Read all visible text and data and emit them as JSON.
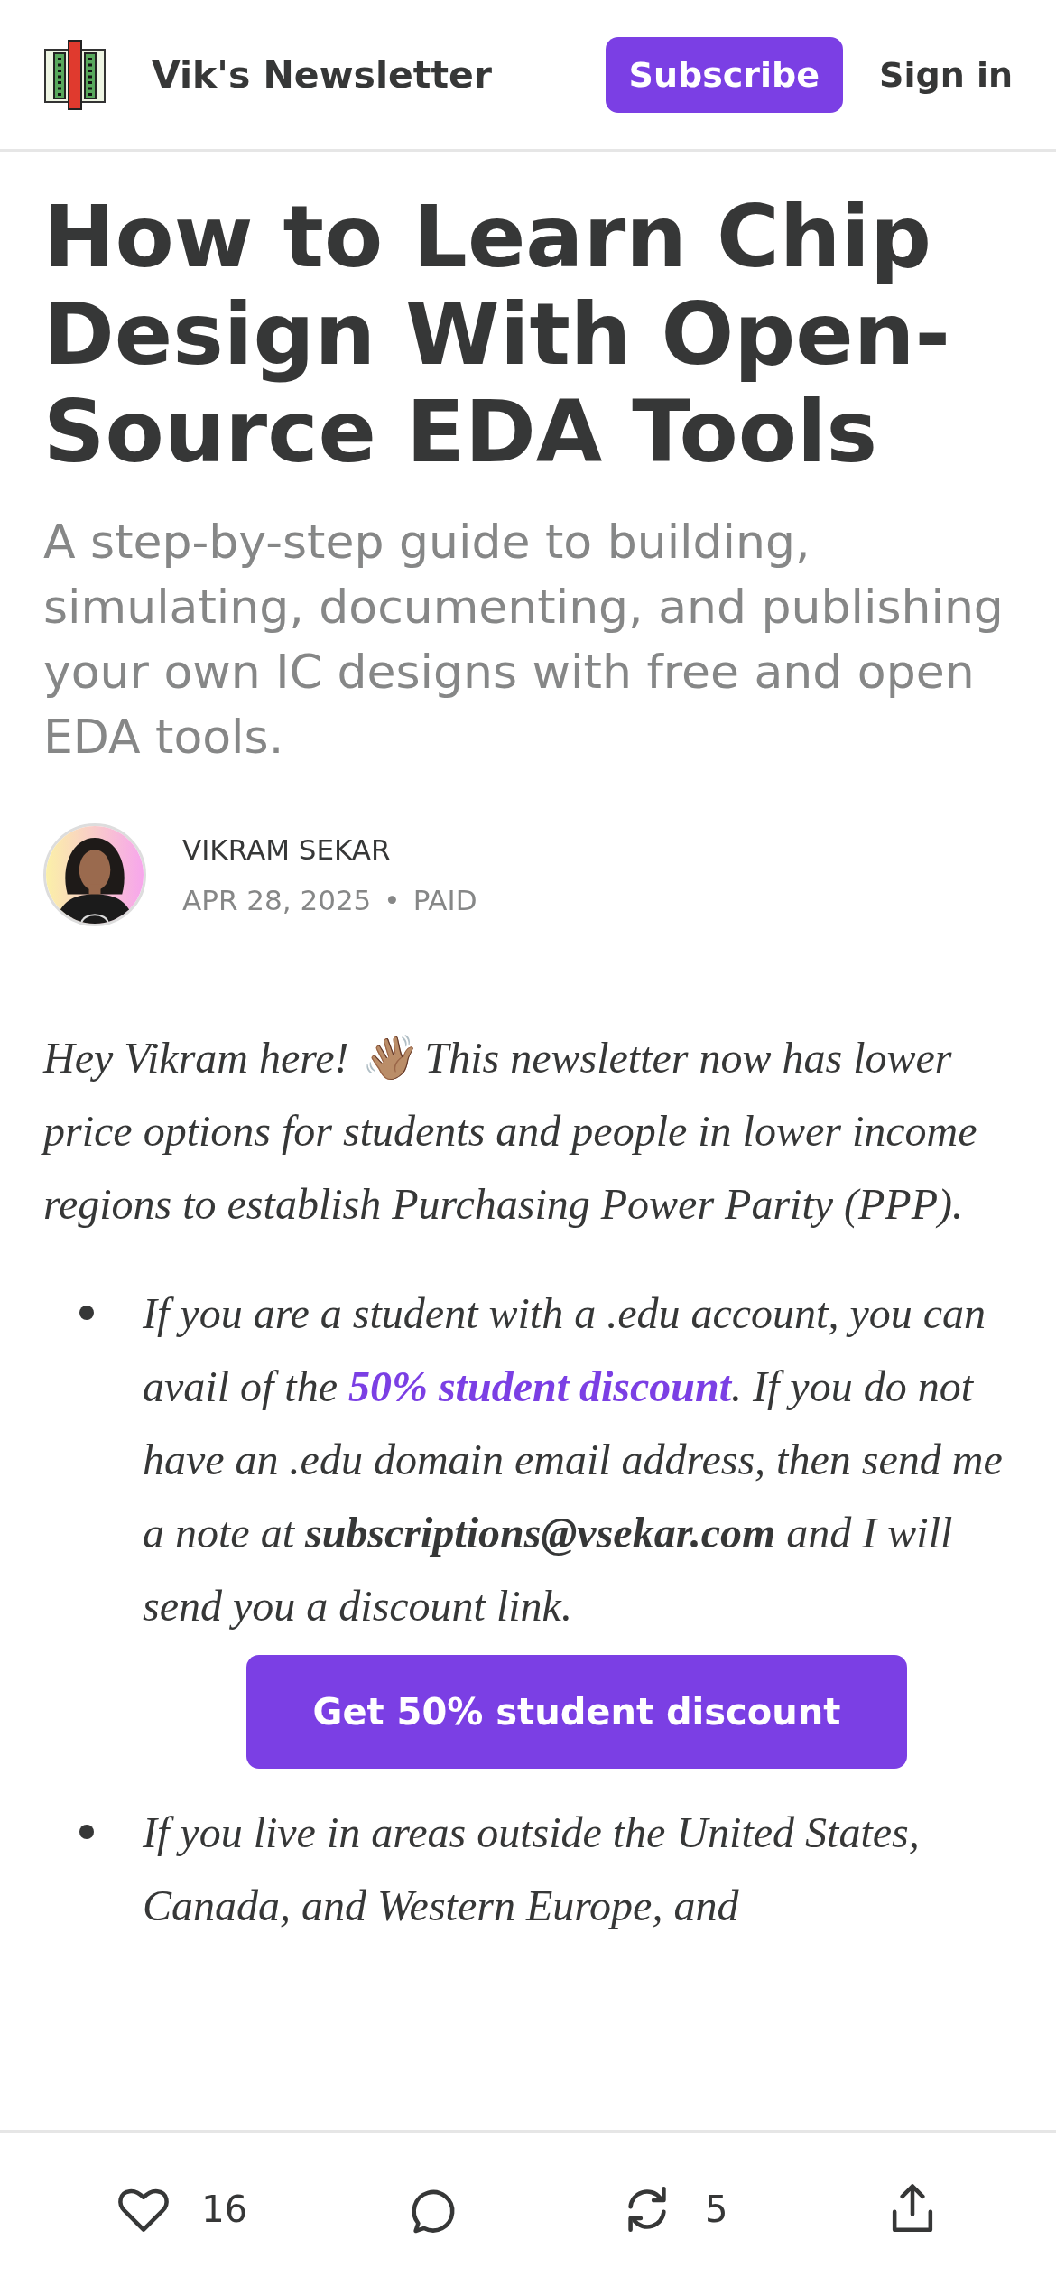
{
  "header": {
    "title": "Vik's Newsletter",
    "subscribe": "Subscribe",
    "sign_in": "Sign in"
  },
  "post": {
    "title": "How to Learn Chip Design With Open-Source EDA Tools",
    "subtitle": "A step-by-step guide to building, simulating, documenting, and publishing your own IC designs with free and open EDA tools.",
    "author": "VIKRAM SEKAR",
    "date": "APR 28, 2025",
    "separator": "•",
    "access": "PAID"
  },
  "body": {
    "intro": "Hey Vikram here! 👋🏽 This newsletter now has lower price options for students and people in lower income regions to establish Purchasing Power Parity (PPP).",
    "bullets": [
      {
        "before": "If you are a student with a .edu account, you can avail of the ",
        "link": "50% student discount",
        "after": ". If you do not have an .edu domain email address, then send me a note at **subscriptions@vsekar.com** and I will send you a discount link.",
        "button": "Get 50% student discount"
      },
      {
        "before": "If you live in areas outside the United States, Canada, and Western Europe, and"
      }
    ]
  },
  "actions": {
    "likes": "16",
    "restacks": "5"
  }
}
